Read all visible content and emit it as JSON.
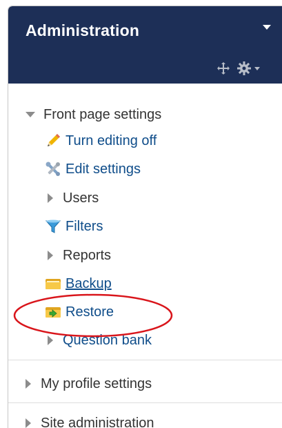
{
  "block": {
    "title": "Administration",
    "header_color": "#1d2f57",
    "icons": {
      "collapse": "triangle-down-icon",
      "move": "move-cross-icon",
      "actions": "gear-icon"
    }
  },
  "tree": {
    "front_page": {
      "label": "Front page settings",
      "expanded": true,
      "items": [
        {
          "label": "Turn editing off",
          "icon": "pencil-icon"
        },
        {
          "label": "Edit settings",
          "icon": "tools-icon"
        },
        {
          "label": "Users",
          "icon": "expand-arrow-icon"
        },
        {
          "label": "Filters",
          "icon": "funnel-icon"
        },
        {
          "label": "Reports",
          "icon": "expand-arrow-icon"
        },
        {
          "label": "Backup",
          "icon": "folder-icon"
        },
        {
          "label": "Restore",
          "icon": "folder-restore-icon"
        },
        {
          "label": "Question bank",
          "icon": "expand-arrow-icon"
        }
      ]
    },
    "my_profile": {
      "label": "My profile settings"
    },
    "site_admin": {
      "label": "Site administration"
    }
  },
  "colors": {
    "link": "#0f4d8a",
    "annotation": "#d9151b"
  }
}
